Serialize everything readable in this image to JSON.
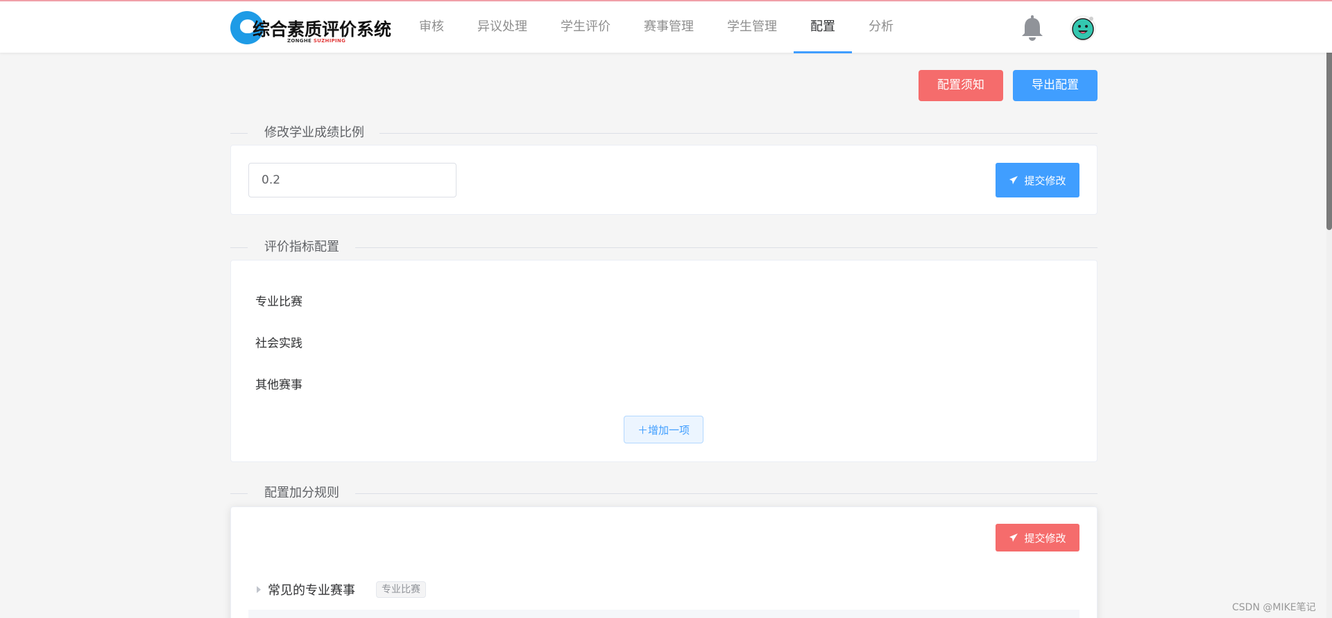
{
  "app": {
    "logo_title": "综合素质评价系统",
    "logo_sub_a": "ZONGHE",
    "logo_sub_b": "SUZHIPING"
  },
  "nav": [
    {
      "label": "审核",
      "active": false
    },
    {
      "label": "异议处理",
      "active": false
    },
    {
      "label": "学生评价",
      "active": false
    },
    {
      "label": "赛事管理",
      "active": false
    },
    {
      "label": "学生管理",
      "active": false
    },
    {
      "label": "配置",
      "active": true
    },
    {
      "label": "分析",
      "active": false
    }
  ],
  "header_icons": {
    "notify": "bell-icon",
    "user": "smiley-avatar-icon"
  },
  "toolbar": {
    "notice_label": "配置须知",
    "export_label": "导出配置"
  },
  "score_ratio": {
    "title": "修改学业成绩比例",
    "value": "0.2",
    "submit_label": "提交修改"
  },
  "index_config": {
    "title": "评价指标配置",
    "items": [
      "专业比赛",
      "社会实践",
      "其他赛事"
    ],
    "add_label": "＋增加一项"
  },
  "bonus_rules": {
    "title": "配置加分规则",
    "submit_label": "提交修改",
    "groups": [
      {
        "name": "常见的专业赛事",
        "tag": "专业比赛"
      }
    ]
  },
  "watermark": "CSDN @MIKE笔记",
  "colors": {
    "primary": "#409eff",
    "danger": "#f56c6c",
    "background": "#f5f5f5"
  }
}
